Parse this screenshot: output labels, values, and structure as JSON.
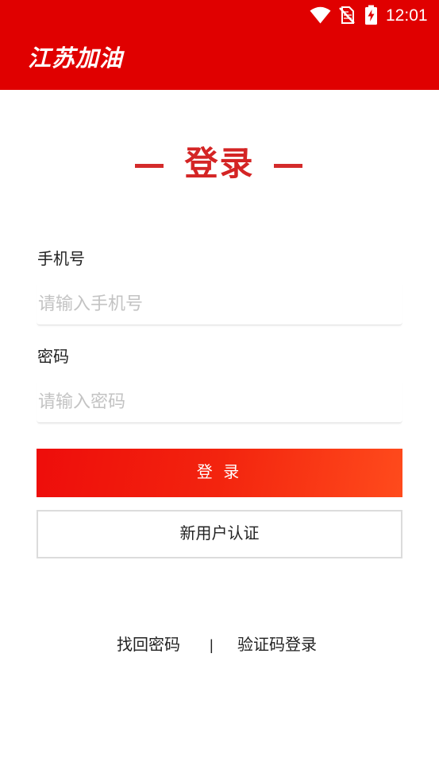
{
  "status_bar": {
    "time": "12:01",
    "icons": [
      "wifi-icon",
      "no-sim-icon",
      "battery-charging-icon"
    ]
  },
  "header": {
    "title": "江苏加油"
  },
  "page": {
    "heading": "登录"
  },
  "form": {
    "phone": {
      "label": "手机号",
      "placeholder": "请输入手机号",
      "value": ""
    },
    "password": {
      "label": "密码",
      "placeholder": "请输入密码",
      "value": ""
    }
  },
  "buttons": {
    "login": "登 录",
    "register": "新用户认证"
  },
  "links": {
    "forgot_password": "找回密码",
    "separator": "|",
    "sms_login": "验证码登录"
  },
  "colors": {
    "header_bg": "#e00000",
    "heading": "#d42424",
    "login_gradient_start": "#ee0d0b",
    "login_gradient_end": "#ff4b1c",
    "placeholder": "#c3c3c3",
    "text": "#222222"
  }
}
